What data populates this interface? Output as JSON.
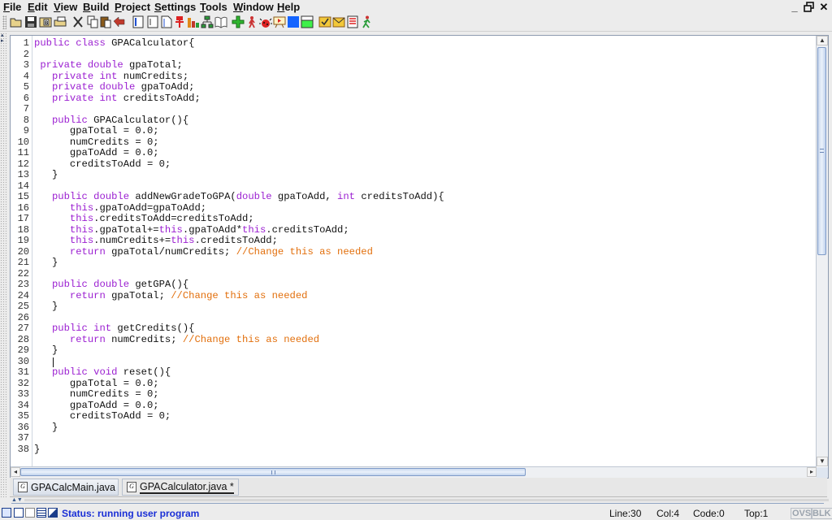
{
  "menubar": {
    "items": [
      {
        "label": "File",
        "mnemonic": "F",
        "rest": "ile"
      },
      {
        "label": "Edit",
        "mnemonic": "E",
        "rest": "dit"
      },
      {
        "label": "View",
        "mnemonic": "V",
        "rest": "iew"
      },
      {
        "label": "Build",
        "mnemonic": "B",
        "rest": "uild"
      },
      {
        "label": "Project",
        "mnemonic": "P",
        "rest": "roject"
      },
      {
        "label": "Settings",
        "mnemonic": "S",
        "rest": "ettings"
      },
      {
        "label": "Tools",
        "mnemonic": "T",
        "rest": "ools"
      },
      {
        "label": "Window",
        "mnemonic": "W",
        "rest": "indow"
      },
      {
        "label": "Help",
        "mnemonic": "H",
        "rest": "elp"
      }
    ],
    "window_controls": {
      "minimize": "_",
      "restore": "▭",
      "close": "✕"
    }
  },
  "toolbar": {
    "buttons": [
      "open-icon",
      "save-icon",
      "browse-icon",
      "print-icon",
      "cut-icon",
      "copy-icon",
      "paste-icon",
      "undo-icon",
      "generate-csd-icon",
      "remove-csd-icon",
      "fold-icon",
      "breakpoint-icon",
      "chart-icon",
      "uml-icon",
      "documentation-icon",
      "compile-icon",
      "run-icon",
      "debug-icon",
      "interactions-icon",
      "blue-view-icon",
      "green-view-icon",
      "check-icon",
      "mail-icon",
      "document-icon",
      "run-figure-icon"
    ]
  },
  "editor": {
    "lines": [
      {
        "n": "1",
        "parts": [
          [
            "kw",
            "public class "
          ],
          [
            "t",
            "GPACalculator{"
          ]
        ]
      },
      {
        "n": "2",
        "parts": []
      },
      {
        "n": "3",
        "parts": [
          [
            "t",
            " "
          ],
          [
            "kw",
            "private double "
          ],
          [
            "t",
            "gpaTotal;"
          ]
        ]
      },
      {
        "n": "4",
        "parts": [
          [
            "t",
            "   "
          ],
          [
            "kw",
            "private int "
          ],
          [
            "t",
            "numCredits;"
          ]
        ]
      },
      {
        "n": "5",
        "parts": [
          [
            "t",
            "   "
          ],
          [
            "kw",
            "private double "
          ],
          [
            "t",
            "gpaToAdd;"
          ]
        ]
      },
      {
        "n": "6",
        "parts": [
          [
            "t",
            "   "
          ],
          [
            "kw",
            "private int "
          ],
          [
            "t",
            "creditsToAdd;"
          ]
        ]
      },
      {
        "n": "7",
        "parts": []
      },
      {
        "n": "8",
        "parts": [
          [
            "t",
            "   "
          ],
          [
            "kw",
            "public "
          ],
          [
            "t",
            "GPACalculator(){"
          ]
        ]
      },
      {
        "n": "9",
        "parts": [
          [
            "t",
            "      gpaTotal = 0.0;"
          ]
        ]
      },
      {
        "n": "10",
        "parts": [
          [
            "t",
            "      numCredits = 0;"
          ]
        ]
      },
      {
        "n": "11",
        "parts": [
          [
            "t",
            "      gpaToAdd = 0.0;"
          ]
        ]
      },
      {
        "n": "12",
        "parts": [
          [
            "t",
            "      creditsToAdd = 0;"
          ]
        ]
      },
      {
        "n": "13",
        "parts": [
          [
            "t",
            "   }"
          ]
        ]
      },
      {
        "n": "14",
        "parts": []
      },
      {
        "n": "15",
        "parts": [
          [
            "t",
            "   "
          ],
          [
            "kw",
            "public double "
          ],
          [
            "t",
            "addNewGradeToGPA("
          ],
          [
            "kw",
            "double "
          ],
          [
            "t",
            "gpaToAdd, "
          ],
          [
            "kw",
            "int "
          ],
          [
            "t",
            "creditsToAdd){"
          ]
        ]
      },
      {
        "n": "16",
        "parts": [
          [
            "t",
            "      "
          ],
          [
            "kw",
            "this"
          ],
          [
            "t",
            ".gpaToAdd=gpaToAdd;"
          ]
        ]
      },
      {
        "n": "17",
        "parts": [
          [
            "t",
            "      "
          ],
          [
            "kw",
            "this"
          ],
          [
            "t",
            ".creditsToAdd=creditsToAdd;"
          ]
        ]
      },
      {
        "n": "18",
        "parts": [
          [
            "t",
            "      "
          ],
          [
            "kw",
            "this"
          ],
          [
            "t",
            ".gpaTotal+="
          ],
          [
            "kw",
            "this"
          ],
          [
            "t",
            ".gpaToAdd*"
          ],
          [
            "kw",
            "this"
          ],
          [
            "t",
            ".creditsToAdd;"
          ]
        ]
      },
      {
        "n": "19",
        "parts": [
          [
            "t",
            "      "
          ],
          [
            "kw",
            "this"
          ],
          [
            "t",
            ".numCredits+="
          ],
          [
            "kw",
            "this"
          ],
          [
            "t",
            ".creditsToAdd;"
          ]
        ]
      },
      {
        "n": "20",
        "parts": [
          [
            "t",
            "      "
          ],
          [
            "kw",
            "return "
          ],
          [
            "t",
            "gpaTotal/numCredits; "
          ],
          [
            "cm",
            "//Change this as needed"
          ]
        ]
      },
      {
        "n": "21",
        "parts": [
          [
            "t",
            "   }"
          ]
        ]
      },
      {
        "n": "22",
        "parts": []
      },
      {
        "n": "23",
        "parts": [
          [
            "t",
            "   "
          ],
          [
            "kw",
            "public double "
          ],
          [
            "t",
            "getGPA(){"
          ]
        ]
      },
      {
        "n": "24",
        "parts": [
          [
            "t",
            "      "
          ],
          [
            "kw",
            "return "
          ],
          [
            "t",
            "gpaTotal; "
          ],
          [
            "cm",
            "//Change this as needed"
          ]
        ]
      },
      {
        "n": "25",
        "parts": [
          [
            "t",
            "   }"
          ]
        ]
      },
      {
        "n": "26",
        "parts": []
      },
      {
        "n": "27",
        "parts": [
          [
            "t",
            "   "
          ],
          [
            "kw",
            "public int "
          ],
          [
            "t",
            "getCredits(){"
          ]
        ]
      },
      {
        "n": "28",
        "parts": [
          [
            "t",
            "      "
          ],
          [
            "kw",
            "return "
          ],
          [
            "t",
            "numCredits; "
          ],
          [
            "cm",
            "//Change this as needed"
          ]
        ]
      },
      {
        "n": "29",
        "parts": [
          [
            "t",
            "   }"
          ]
        ]
      },
      {
        "n": "30",
        "parts": []
      },
      {
        "n": "31",
        "parts": [
          [
            "t",
            "   "
          ],
          [
            "kw",
            "public void "
          ],
          [
            "t",
            "reset(){"
          ]
        ]
      },
      {
        "n": "32",
        "parts": [
          [
            "t",
            "      gpaTotal = 0.0;"
          ]
        ]
      },
      {
        "n": "33",
        "parts": [
          [
            "t",
            "      numCredits = 0;"
          ]
        ]
      },
      {
        "n": "34",
        "parts": [
          [
            "t",
            "      gpaToAdd = 0.0;"
          ]
        ]
      },
      {
        "n": "35",
        "parts": [
          [
            "t",
            "      creditsToAdd = 0;"
          ]
        ]
      },
      {
        "n": "36",
        "parts": [
          [
            "t",
            "   }"
          ]
        ]
      },
      {
        "n": "37",
        "parts": []
      },
      {
        "n": "38",
        "parts": [
          [
            "t",
            "}"
          ]
        ]
      }
    ],
    "caret_line": 30,
    "caret_col": 4,
    "colors": {
      "keyword": "#9b1fd1",
      "comment": "#e26f0c",
      "text": "#111111"
    }
  },
  "tabs": [
    {
      "label": "GPACalcMain.java",
      "icon": "G",
      "active": false
    },
    {
      "label": "GPACalculator.java *",
      "icon": "G",
      "active": true
    }
  ],
  "statusbar": {
    "status": "Status: running user program",
    "line": "Line:30",
    "col": "Col:4",
    "code": "Code:0",
    "top": "Top:1",
    "ovs": "OVS",
    "blk": "BLK",
    "status_color": "#1a2fd6"
  }
}
